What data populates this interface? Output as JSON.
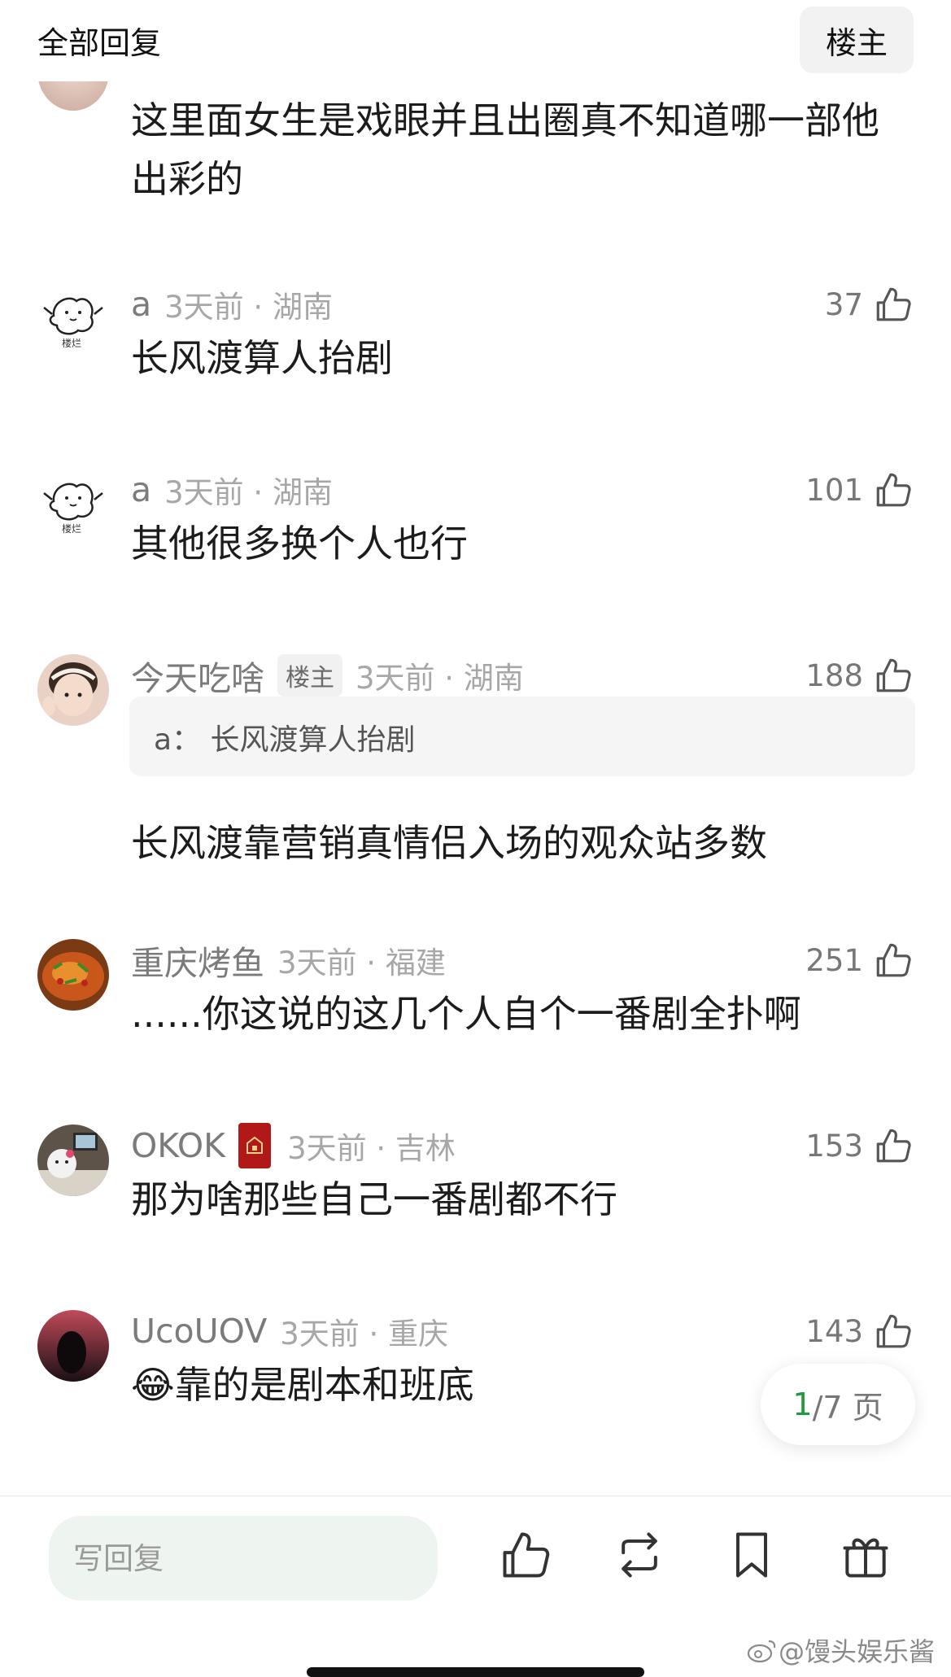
{
  "header": {
    "title": "全部回复",
    "op_button": "楼主"
  },
  "partial_comment": {
    "text": "这里面女生是戏眼并且出圈真不知道哪一部他出彩的"
  },
  "comments": [
    {
      "username": "a",
      "time": "3天前",
      "location": "湖南",
      "likes": "37",
      "text": "长风渡算人抬剧"
    },
    {
      "username": "a",
      "time": "3天前",
      "location": "湖南",
      "likes": "101",
      "text": "其他很多换个人也行"
    },
    {
      "username": "今天吃啥",
      "badge": "楼主",
      "time": "3天前",
      "location": "湖南",
      "likes": "188",
      "quote_user": "a：",
      "quote_text": "长风渡算人抬剧",
      "text": "长风渡靠营销真情侣入场的观众站多数"
    },
    {
      "username": "重庆烤鱼",
      "time": "3天前",
      "location": "福建",
      "likes": "251",
      "text": "......你这说的这几个人自个一番剧全扑啊"
    },
    {
      "username": "OKOK",
      "time": "3天前",
      "location": "吉林",
      "likes": "153",
      "text": "那为啥那些自己一番剧都不行"
    },
    {
      "username": "UcoUOV",
      "time": "3天前",
      "location": "重庆",
      "likes": "143",
      "emoji": "😂",
      "text": "靠的是剧本和班底"
    }
  ],
  "separator": " · ",
  "pager": {
    "current": "1",
    "rest": "/7 页"
  },
  "bottom_bar": {
    "reply_placeholder": "写回复",
    "watermark": "@馒头娱乐酱"
  },
  "colors": {
    "accent_green": "#1f9a3c",
    "text": "#1c1c1c",
    "meta": "#a7a7a7"
  }
}
